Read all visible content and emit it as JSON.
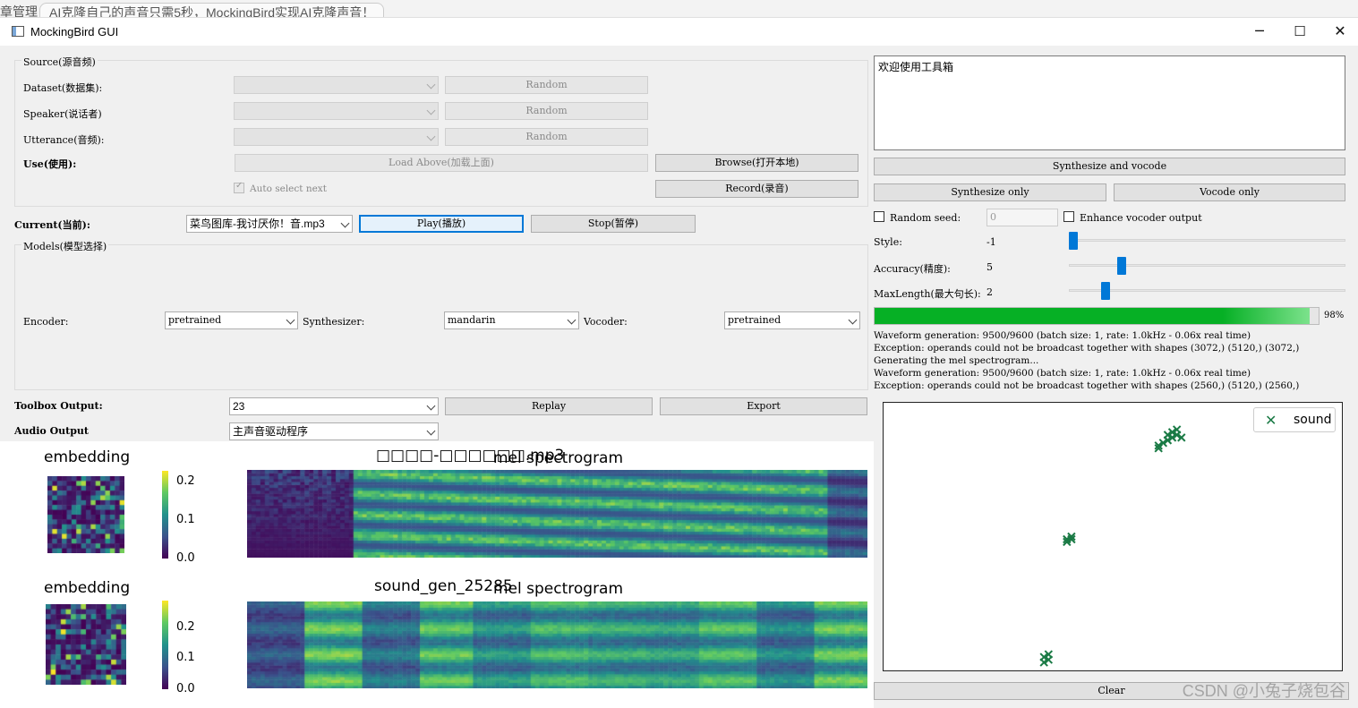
{
  "browser": {
    "tab_left": "章管理",
    "tab_active": "AI克隆自己的声音只需5秒，MockingBird实现AI克隆声音！"
  },
  "window": {
    "title": "MockingBird GUI",
    "minimize": "─",
    "maximize": "☐",
    "close": "✕"
  },
  "source": {
    "legend": "Source(源音频)",
    "dataset_label": "Dataset(数据集):",
    "speaker_label": "Speaker(说话者)",
    "utterance_label": "Utterance(音频):",
    "use_label": "Use(使用):",
    "random_label": "Random",
    "load_above": "Load Above(加载上面)",
    "browse": "Browse(打开本地)",
    "record": "Record(录音)",
    "auto_select": "Auto select next"
  },
  "current": {
    "label": "Current(当前):",
    "value": "菜鸟图库-我讨厌你！音.mp3",
    "play": "Play(播放)",
    "stop": "Stop(暂停)"
  },
  "models": {
    "legend": "Models(模型选择)",
    "encoder_label": "Encoder:",
    "encoder_value": "pretrained",
    "synthesizer_label": "Synthesizer:",
    "synthesizer_value": "mandarin",
    "vocoder_label": "Vocoder:",
    "vocoder_value": "pretrained"
  },
  "toolbox": {
    "label": "Toolbox Output:",
    "value": "23",
    "replay": "Replay",
    "export": "Export",
    "audio_label": "Audio Output",
    "audio_value": "主声音驱动程序"
  },
  "right": {
    "text_input": "欢迎使用工具箱",
    "synth_vocode": "Synthesize and vocode",
    "synth_only": "Synthesize only",
    "vocode_only": "Vocode only",
    "random_seed": "Random seed:",
    "seed_value": "0",
    "enhance": "Enhance vocoder output",
    "style_label": "Style:",
    "style_value": "-1",
    "accuracy_label": "Accuracy(精度):",
    "accuracy_value": "5",
    "maxlength_label": "MaxLength(最大句长):",
    "maxlength_value": "2",
    "progress_pct": 98,
    "progress_label": "98%",
    "clear": "Clear"
  },
  "sliders": {
    "style_fraction": 0.0,
    "accuracy_fraction": 0.18,
    "maxlength_fraction": 0.12
  },
  "log": [
    "Waveform generation: 9500/9600 (batch size: 1, rate: 1.0kHz - 0.06x real time)",
    "Exception: operands could not be broadcast together with shapes (3072,) (5120,) (3072,)",
    "Generating the mel spectrogram...",
    "Waveform generation: 9500/9600 (batch size: 1, rate: 1.0kHz - 0.06x real time)",
    "Exception: operands could not be broadcast together with shapes (2560,) (5120,) (2560,)"
  ],
  "plots": {
    "row1": {
      "embedding_title": "embedding",
      "file_title": "□□□□-□□□□□□.mp3",
      "mel_title": "mel spectrogram",
      "cbar_ticks": [
        "0.2",
        "0.1",
        "0.0"
      ]
    },
    "row2": {
      "embedding_title": "embedding",
      "file_title": "sound_gen_25285",
      "mel_title": "mel spectrogram",
      "cbar_ticks": [
        "0.2",
        "0.1",
        "0.0"
      ]
    }
  },
  "scatter": {
    "legend_label": "sound",
    "marker_color": "#1a7a45"
  },
  "chart_data": {
    "type": "scatter",
    "title": "",
    "xlabel": "",
    "ylabel": "",
    "series": [
      {
        "name": "sound",
        "x": [
          0.6,
          0.61,
          0.62,
          0.62,
          0.63,
          0.63,
          0.64,
          0.64,
          0.65,
          0.6,
          0.4,
          0.41,
          0.4,
          0.41,
          0.35,
          0.36,
          0.35,
          0.36
        ],
        "y": [
          0.84,
          0.85,
          0.86,
          0.88,
          0.87,
          0.89,
          0.88,
          0.9,
          0.87,
          0.83,
          0.49,
          0.5,
          0.48,
          0.49,
          0.05,
          0.06,
          0.03,
          0.04
        ]
      }
    ]
  },
  "colors": {
    "accent": "#0078d7",
    "progress": "#06b025"
  }
}
